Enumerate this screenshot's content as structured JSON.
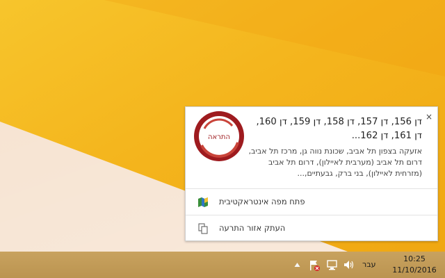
{
  "notification": {
    "title": "דן 156, דן 157, דן 158, דן 159, דן 160, דן 161, דן 162...",
    "body": "אזעקה בצפון תל אביב, שכונת נווה גן, מרכז תל אביב, דרום תל אביב (מערבית לאיילון), דרום תל אביב (מזרחית לאיילון), בני ברק, גבעתיים,...",
    "close_glyph": "×",
    "logo_text": "התראה",
    "logo_colors": {
      "ring": "#9e1b1f",
      "ring_light": "#c9443a"
    },
    "actions": [
      {
        "label": "פתח מפה אינטראקטיבית",
        "icon": "map-icon"
      },
      {
        "label": "העתק אזור התרעה",
        "icon": "copy-icon"
      }
    ]
  },
  "taskbar": {
    "language": "עבר",
    "time": "10:25",
    "date": "11/10/2016",
    "tray_icons": [
      "chevron-up-icon",
      "flag-alert-icon",
      "network-icon",
      "volume-icon"
    ]
  }
}
